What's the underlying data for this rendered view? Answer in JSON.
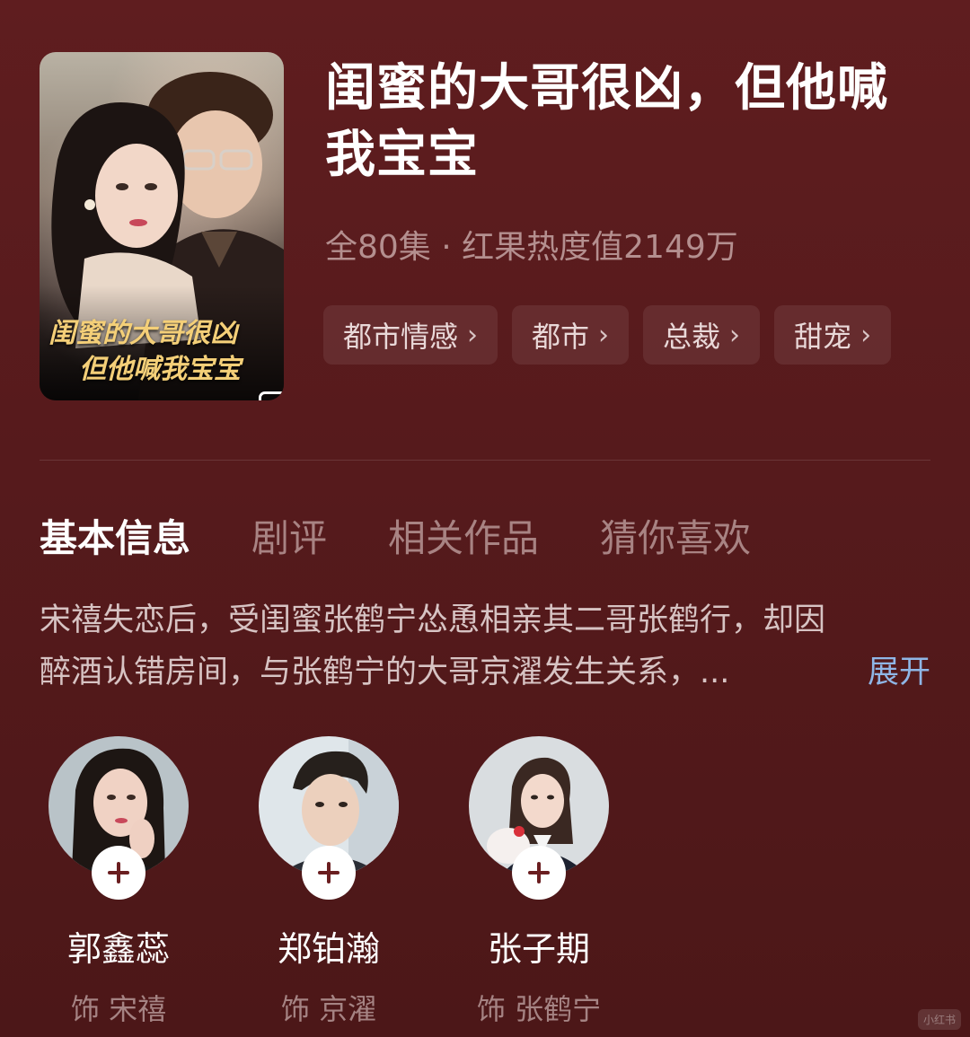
{
  "drama": {
    "title": "闺蜜的大哥很凶，但他喊我宝宝",
    "meta": "全80集 · 红果热度值2149万",
    "poster_caption_line1": "闺蜜的大哥很凶",
    "poster_caption_line2": "但他喊我宝宝",
    "tags": [
      {
        "label": "都市情感",
        "icon": "chevron-right-icon"
      },
      {
        "label": "都市",
        "icon": "chevron-right-icon"
      },
      {
        "label": "总裁",
        "icon": "chevron-right-icon"
      },
      {
        "label": "甜宠",
        "icon": "chevron-right-icon"
      }
    ]
  },
  "tabs": [
    {
      "label": "基本信息",
      "active": true
    },
    {
      "label": "剧评",
      "active": false
    },
    {
      "label": "相关作品",
      "active": false
    },
    {
      "label": "猜你喜欢",
      "active": false
    }
  ],
  "synopsis": {
    "line1": "宋禧失恋后，受闺蜜张鹤宁怂恿相亲其二哥张鹤行，却因",
    "line2": "醉酒认错房间，与张鹤宁的大哥京濯发生关系，...",
    "expand_label": "展开"
  },
  "cast": [
    {
      "name": "郭鑫蕊",
      "role": "饰 宋禧",
      "follow_icon": "plus-icon"
    },
    {
      "name": "郑铂瀚",
      "role": "饰 京濯",
      "follow_icon": "plus-icon"
    },
    {
      "name": "张子期",
      "role": "饰 张鹤宁",
      "follow_icon": "plus-icon"
    }
  ],
  "watermark": "小红书",
  "colors": {
    "background": "#5a1b1d",
    "title": "#ffffff",
    "meta": "#b48f8f",
    "expand_link": "#8fb6e6"
  }
}
